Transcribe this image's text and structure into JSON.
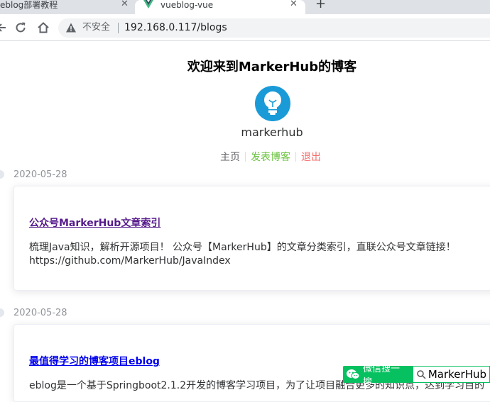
{
  "browser": {
    "tabs": [
      {
        "title": "eblog部署教程"
      },
      {
        "title": "vueblog-vue"
      }
    ],
    "new_tab_symbol": "+",
    "close_symbol": "✕",
    "omnibox": {
      "security_label": "不安全",
      "url": "192.168.0.117/blogs"
    }
  },
  "page": {
    "title": "欢迎来到MarkerHub的博客",
    "username": "markerhub",
    "nav": {
      "home": "主页",
      "new_post": "发表博客",
      "logout": "退出"
    },
    "posts": [
      {
        "date": "2020-05-28",
        "title": "公众号MarkerHub文章索引",
        "description": "梳理Java知识，解析开源项目！ 公众号【MarkerHub】的文章分类索引，直联公众号文章链接！https://github.com/MarkerHub/JavaIndex"
      },
      {
        "date": "2020-05-28",
        "title": "最值得学习的博客项目eblog",
        "description": "eblog是一个基于Springboot2.1.2开发的博客学习项目，为了让项目融合更多的知识点，达到学习目的"
      }
    ]
  },
  "watermark": {
    "left": "微信搜一搜",
    "right": "MarkerHub"
  },
  "colors": {
    "link_visited": "#551a8b",
    "link": "#0000ee",
    "nav_green": "#67c23a",
    "nav_red": "#f56c6c",
    "wechat_green": "#07c160",
    "avatar_blue": "#1a9bd7"
  },
  "icons": [
    "vue-icon",
    "back-icon",
    "reload-icon",
    "home-icon",
    "warning-icon",
    "lightbulb-avatar",
    "wechat-icon",
    "search-icon"
  ]
}
